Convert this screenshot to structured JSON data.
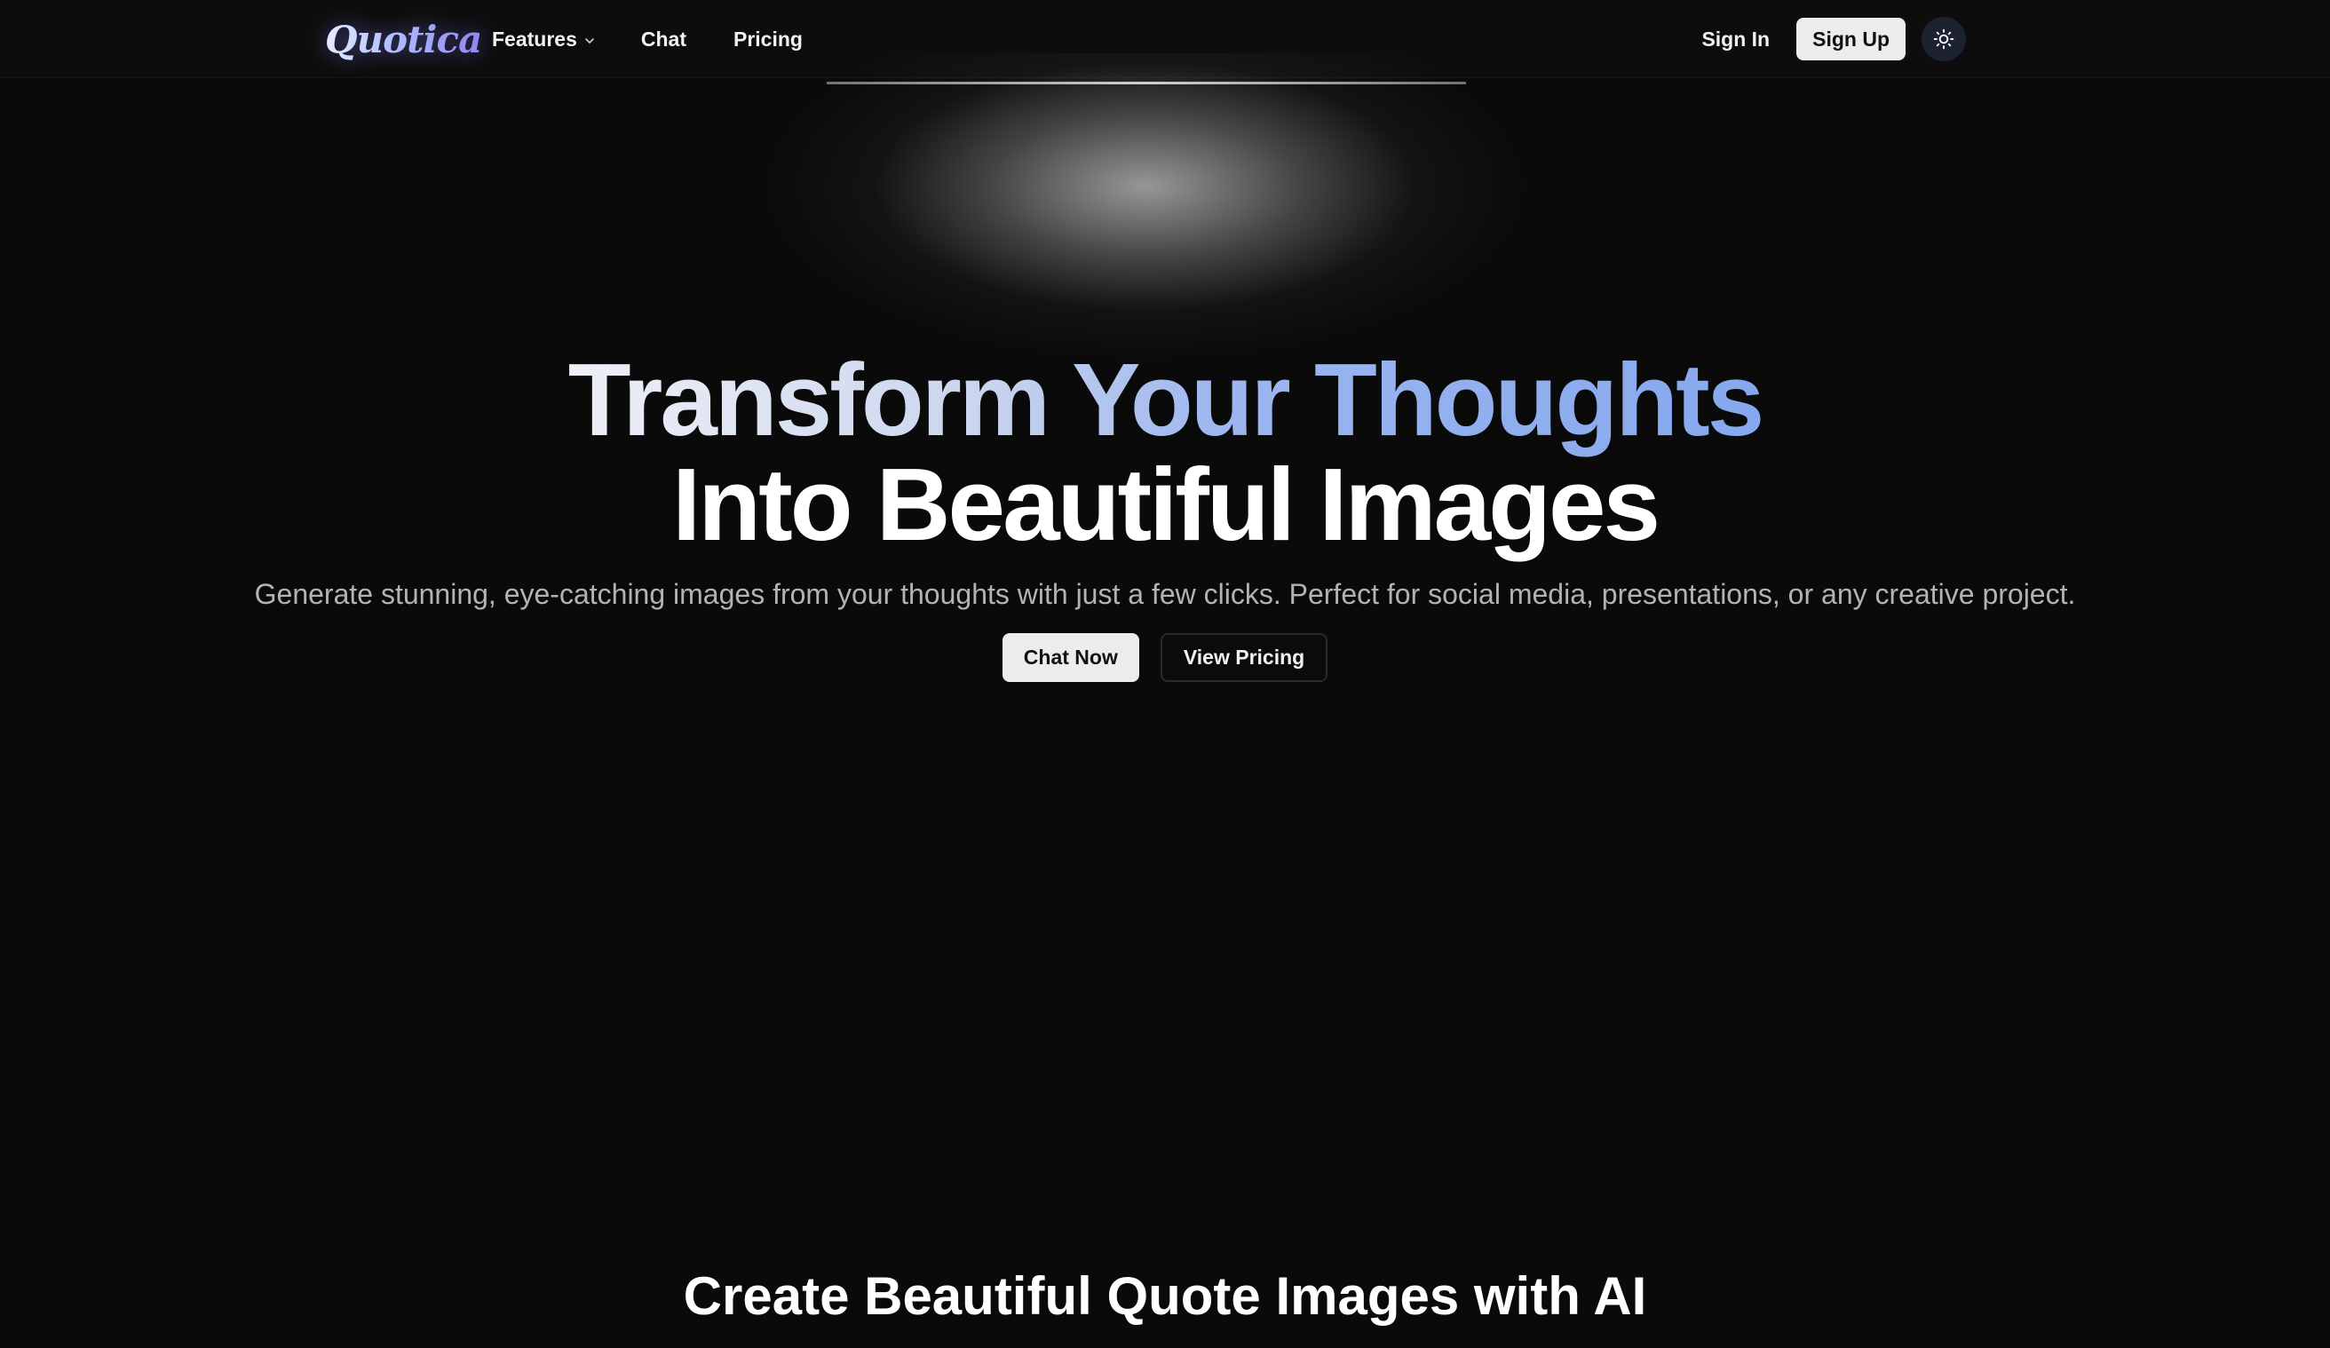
{
  "nav": {
    "logo_text": "Quotica",
    "links": [
      {
        "label": "Features"
      },
      {
        "label": "Chat"
      },
      {
        "label": "Pricing"
      }
    ],
    "sign_in_label": "Sign In",
    "sign_up_label": "Sign Up",
    "theme_icon": "sun-icon"
  },
  "hero": {
    "title_line1": "Transform Your Thoughts",
    "title_line2": "Into Beautiful Images",
    "subtitle": "Generate stunning, eye-catching images from your thoughts with just a few clicks. Perfect for social media, presentations, or any creative project.",
    "primary_cta": "Chat Now",
    "secondary_cta": "View Pricing"
  },
  "section": {
    "title": "Create Beautiful Quote Images with AI"
  },
  "colors": {
    "background": "#0a0a0a",
    "accent_blue": "#86a8ee",
    "button_light": "#ececec"
  }
}
